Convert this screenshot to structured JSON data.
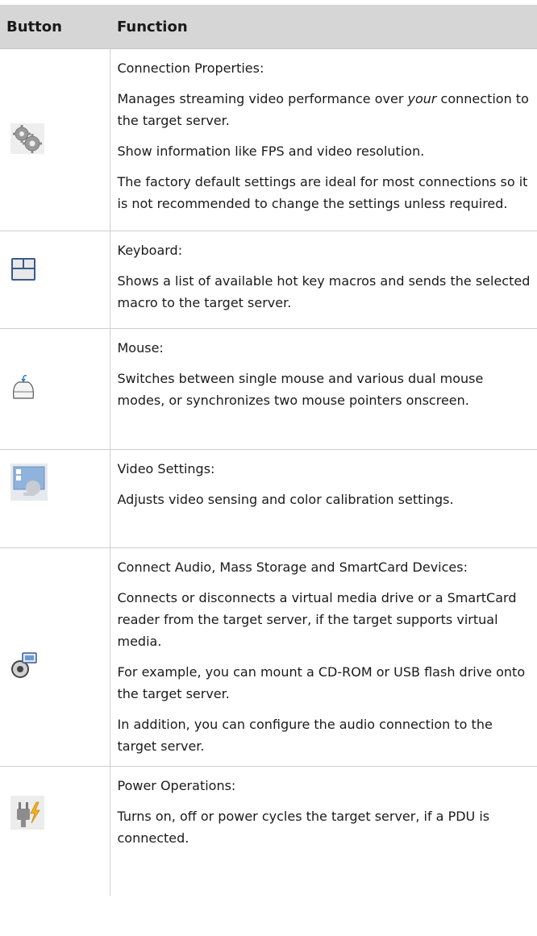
{
  "table": {
    "headers": {
      "button": "Button",
      "function": "Function"
    },
    "rows": [
      {
        "icon": "gears-icon",
        "paragraphs": [
          "Connection Properties:",
          "",
          "Show information like FPS and video resolution.",
          "The factory default settings are ideal for most connections so it is not recommended to change the settings unless required."
        ],
        "p2_before": "Manages streaming video performance over ",
        "p2_em": "your",
        "p2_after": " connection to the target server."
      },
      {
        "icon": "keyboard-icon",
        "paragraphs": [
          "Keyboard:",
          "Shows a list of available hot key macros and sends the selected macro to the target server."
        ]
      },
      {
        "icon": "mouse-icon",
        "paragraphs": [
          "Mouse:",
          "Switches between single mouse and various dual mouse modes, or synchronizes two mouse pointers onscreen."
        ]
      },
      {
        "icon": "video-settings-icon",
        "paragraphs": [
          "Video Settings:",
          "Adjusts video sensing and color calibration settings."
        ]
      },
      {
        "icon": "virtual-media-icon",
        "paragraphs": [
          "Connect Audio, Mass Storage and SmartCard Devices:",
          "Connects or disconnects a virtual media drive or a SmartCard reader from the target server, if the target supports virtual media.",
          "For example, you can mount a CD-ROM or USB flash drive onto the target server.",
          "In addition, you can configure the audio connection to the target server."
        ]
      },
      {
        "icon": "power-plug-icon",
        "paragraphs": [
          "Power Operations:",
          "Turns on, off or power cycles the target server, if a PDU is connected."
        ]
      }
    ]
  }
}
